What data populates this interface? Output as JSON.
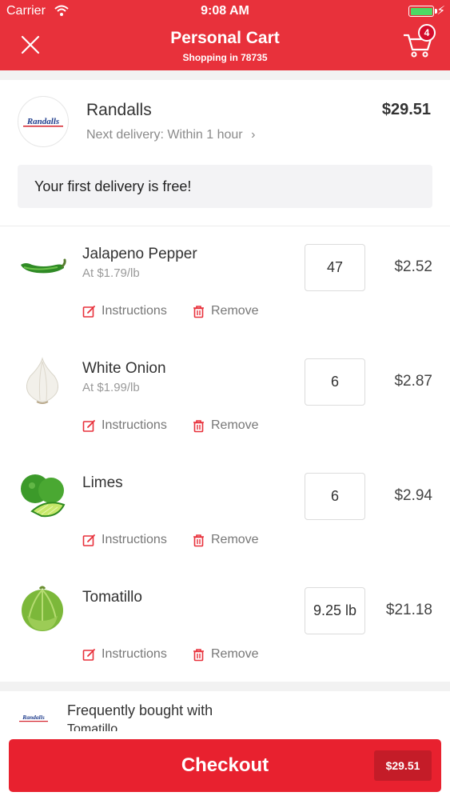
{
  "status_bar": {
    "carrier": "Carrier",
    "time": "9:08 AM"
  },
  "header": {
    "title": "Personal Cart",
    "subtitle": "Shopping in 78735",
    "cart_badge": "4"
  },
  "store": {
    "name": "Randalls",
    "logo_text": "Randalls",
    "total": "$29.51",
    "delivery": "Next delivery: Within 1 hour",
    "delivery_chevron": "›",
    "free_delivery_note": "Your first delivery is free!"
  },
  "items": [
    {
      "name": "Jalapeno Pepper",
      "unit_price": "At $1.79/lb",
      "quantity": "47",
      "price": "$2.52",
      "image": "jalapeno-image"
    },
    {
      "name": "White Onion",
      "unit_price": "At $1.99/lb",
      "quantity": "6",
      "price": "$2.87",
      "image": "onion-image"
    },
    {
      "name": "Limes",
      "unit_price": "",
      "quantity": "6",
      "price": "$2.94",
      "image": "limes-image"
    },
    {
      "name": "Tomatillo",
      "unit_price": "",
      "quantity": "9.25 lb",
      "price": "$21.18",
      "image": "tomatillo-image"
    }
  ],
  "actions": {
    "instructions": "Instructions",
    "remove": "Remove"
  },
  "frequently_bought": {
    "title": "Frequently bought with",
    "subtitle": "Tomatillo",
    "logo_text": "Randalls"
  },
  "checkout": {
    "label": "Checkout",
    "total": "$29.51"
  },
  "colors": {
    "brand_red": "#e8313b",
    "checkout_red": "#e8212f",
    "badge_red": "#d40b2b",
    "battery_green": "#4cd964"
  }
}
